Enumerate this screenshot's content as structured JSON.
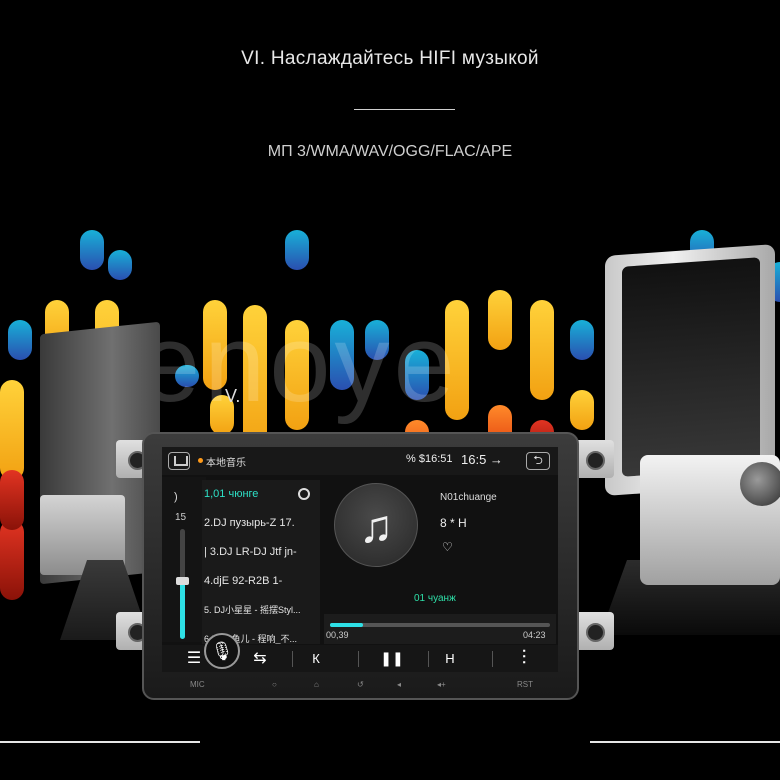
{
  "header": {
    "headline": "VI. Наслаждайтесь HIFI музыкой",
    "formats": "МП 3/WMA/WAV/OGG/FLAC/APE",
    "watermark": "yenoye",
    "label": "V."
  },
  "statusbar": {
    "app_name": "本地音乐",
    "time_left": "% $16:51",
    "time_right": "16:5 →",
    "back_glyph": "⮌"
  },
  "volume": {
    "mark": ")",
    "level": "15",
    "fraction": 0.53
  },
  "playlist": {
    "items": [
      {
        "label": "1,01 чюнге",
        "active": true
      },
      {
        "label": "2.DJ пузырь-Z 17.",
        "active": false
      },
      {
        "label": "| 3.DJ LR-DJ Jtf jn-",
        "active": false
      },
      {
        "label": "4.djE 92-R2B 1-",
        "active": false
      },
      {
        "label": "5. DJ小星星 - 摇摆Styl...",
        "active": false
      },
      {
        "label": "6.DJ小鱼儿 - 程响_不...",
        "active": false
      }
    ]
  },
  "now": {
    "art_glyph": "♫",
    "title": "N01chuange",
    "artist": "8 * H",
    "heart": "♡",
    "playing_label": "01 чуанж",
    "elapsed": "00,39",
    "total": "04:23",
    "progress": 0.15
  },
  "controls": {
    "list": "☰",
    "mic": "🎙",
    "repeat": "⇆",
    "prev": "К",
    "pause": "❚❚",
    "next": "Н",
    "eq": "⫶"
  },
  "hardware": {
    "mic": "MIC",
    "power": "○",
    "home": "⌂",
    "back": "↺",
    "vol_down": "◂",
    "vol_up": "◂+",
    "rst": "RST"
  },
  "colors": {
    "accent": "#2ee0e6",
    "active_text": "#2ee0c6",
    "bar_blue": "#1f8ad0",
    "bar_yellow": "#ffc62a",
    "bar_orange": "#ff6a1a",
    "bar_red": "#d02a1a"
  }
}
